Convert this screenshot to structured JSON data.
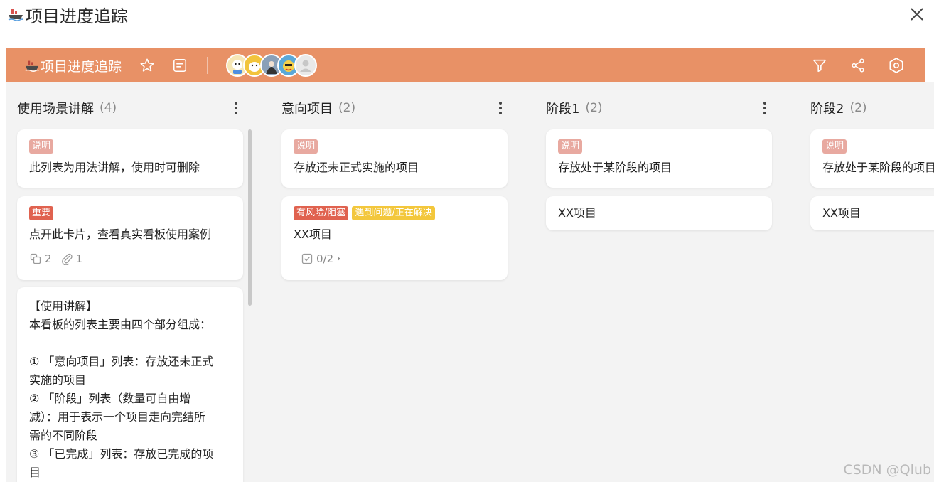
{
  "window": {
    "title": "项目进度追踪",
    "close_icon": "close-icon"
  },
  "board": {
    "name": "项目进度追踪",
    "accent_color": "#e89166",
    "icons": {
      "star": "star-icon",
      "notes": "notes-icon",
      "filter": "filter-icon",
      "share": "share-icon",
      "settings": "settings-icon"
    }
  },
  "members": [
    "avatar-1",
    "avatar-2",
    "avatar-3",
    "avatar-4",
    "avatar-5"
  ],
  "lists": [
    {
      "title": "使用场景讲解",
      "count": "(4)",
      "cards": [
        {
          "tags": [
            {
              "label": "说明",
              "color": "#e8a9a0"
            }
          ],
          "title": "此列表为用法讲解，使用时可删除"
        },
        {
          "tags": [
            {
              "label": "重要",
              "color": "#e0624f"
            }
          ],
          "title": "点开此卡片，查看真实看板使用案例",
          "subtasks": "2",
          "attachments": "1"
        },
        {
          "lines": [
            "【使用讲解】",
            "本看板的列表主要由四个部分组成：",
            "",
            "① 「意向项目」列表：存放还未正式",
            "实施的项目",
            "② 「阶段」列表（数量可自由增",
            "减）：用于表示一个项目走向完结所",
            "需的不同阶段",
            "③ 「已完成」列表：存放已完成的项",
            "目"
          ]
        }
      ]
    },
    {
      "title": "意向项目",
      "count": "(2)",
      "cards": [
        {
          "tags": [
            {
              "label": "说明",
              "color": "#e8a9a0"
            }
          ],
          "title": "存放还未正式实施的项目"
        },
        {
          "tags": [
            {
              "label": "有风险/阻塞",
              "color": "#e0624f"
            },
            {
              "label": "遇到问题/正在解决",
              "color": "#f3c73c"
            }
          ],
          "title": "XX项目",
          "checklist": "0/2"
        }
      ]
    },
    {
      "title": "阶段1",
      "count": "(2)",
      "cards": [
        {
          "tags": [
            {
              "label": "说明",
              "color": "#e8a9a0"
            }
          ],
          "title": "存放处于某阶段的项目"
        },
        {
          "title": "XX项目"
        }
      ]
    },
    {
      "title": "阶段2",
      "count": "(2)",
      "cards": [
        {
          "tags": [
            {
              "label": "说明",
              "color": "#e8a9a0"
            }
          ],
          "title": "存放处于某阶段的项目"
        },
        {
          "title": "XX项目"
        }
      ]
    }
  ],
  "watermark": "CSDN @Qlub"
}
